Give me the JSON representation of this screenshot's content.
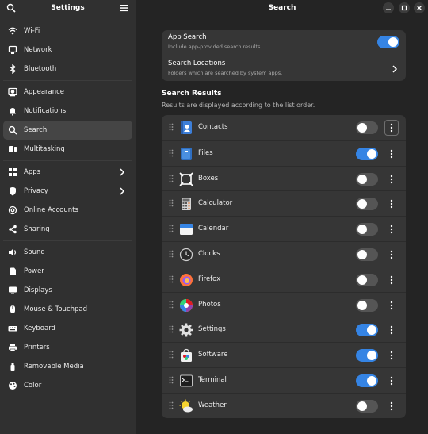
{
  "sidebar": {
    "title": "Settings",
    "items": [
      {
        "label": "Wi-Fi",
        "icon": "wifi-icon"
      },
      {
        "label": "Network",
        "icon": "network-icon"
      },
      {
        "label": "Bluetooth",
        "icon": "bluetooth-icon"
      },
      {
        "label": "Appearance",
        "icon": "appearance-icon"
      },
      {
        "label": "Notifications",
        "icon": "bell-icon"
      },
      {
        "label": "Search",
        "icon": "search-icon"
      },
      {
        "label": "Multitasking",
        "icon": "multitasking-icon"
      },
      {
        "label": "Apps",
        "icon": "apps-icon"
      },
      {
        "label": "Privacy",
        "icon": "privacy-icon"
      },
      {
        "label": "Online Accounts",
        "icon": "at-icon"
      },
      {
        "label": "Sharing",
        "icon": "share-icon"
      },
      {
        "label": "Sound",
        "icon": "speaker-icon"
      },
      {
        "label": "Power",
        "icon": "power-icon"
      },
      {
        "label": "Displays",
        "icon": "display-icon"
      },
      {
        "label": "Mouse & Touchpad",
        "icon": "mouse-icon"
      },
      {
        "label": "Keyboard",
        "icon": "keyboard-icon"
      },
      {
        "label": "Printers",
        "icon": "printer-icon"
      },
      {
        "label": "Removable Media",
        "icon": "usb-icon"
      },
      {
        "label": "Color",
        "icon": "color-icon"
      }
    ]
  },
  "main": {
    "title": "Search",
    "app_search": {
      "title": "App Search",
      "subtitle": "Include app-provided search results.",
      "enabled": true
    },
    "search_locations": {
      "title": "Search Locations",
      "subtitle": "Folders which are searched by system apps."
    },
    "results_title": "Search Results",
    "results_subtitle": "Results are displayed according to the list order.",
    "apps": [
      {
        "name": "Contacts",
        "enabled": false
      },
      {
        "name": "Files",
        "enabled": true
      },
      {
        "name": "Boxes",
        "enabled": false
      },
      {
        "name": "Calculator",
        "enabled": false
      },
      {
        "name": "Calendar",
        "enabled": false
      },
      {
        "name": "Clocks",
        "enabled": false
      },
      {
        "name": "Firefox",
        "enabled": false
      },
      {
        "name": "Photos",
        "enabled": false
      },
      {
        "name": "Settings",
        "enabled": true
      },
      {
        "name": "Software",
        "enabled": true
      },
      {
        "name": "Terminal",
        "enabled": true
      },
      {
        "name": "Weather",
        "enabled": false
      }
    ]
  },
  "colors": {
    "accent": "#3584e4",
    "sidebar_bg": "#303030",
    "main_bg": "#242424",
    "card_bg": "#363636"
  }
}
